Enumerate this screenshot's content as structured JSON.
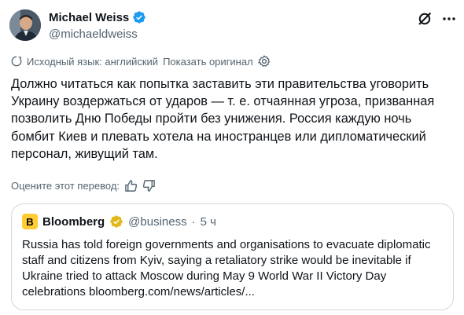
{
  "author": {
    "display_name": "Michael Weiss",
    "handle": "@michaeldweiss"
  },
  "translation": {
    "source_language": "Исходный язык: английский",
    "show_original": "Показать оригинал"
  },
  "tweet": {
    "text": "Должно читаться как попытка заставить эти правительства уговорить Украину воздержаться от ударов — т. е. отчаянная угроза, призванная позволить Дню Победы пройти без унижения. Россия каждую ночь бомбит Киев и плевать хотела на иностранцев или дипломатический персонал, живущий там."
  },
  "rate": {
    "label": "Оцените этот перевод:"
  },
  "quote": {
    "logo_letter": "B",
    "display_name": "Bloomberg",
    "handle": "@business",
    "separator": "·",
    "time": "5 ч",
    "text": "Russia has told foreign governments and organisations to evacuate diplomatic staff and citizens from Kyiv, saying a retaliatory strike would be inevitable if Ukraine tried to attack Moscow during May 9 World War II Victory Day celebrations bloomberg.com/news/articles/..."
  },
  "colors": {
    "verified_blue": "#1d9bf0",
    "verified_gold": "#e2b719",
    "secondary_text": "#536471",
    "border": "#cfd9de",
    "bloomberg_yellow": "#ffcc33"
  },
  "icons": {
    "grok": "grok-icon",
    "more": "more-icon",
    "translate": "translate-icon",
    "settings": "gear-icon",
    "thumbs_up": "thumbs-up-icon",
    "thumbs_down": "thumbs-down-icon"
  }
}
